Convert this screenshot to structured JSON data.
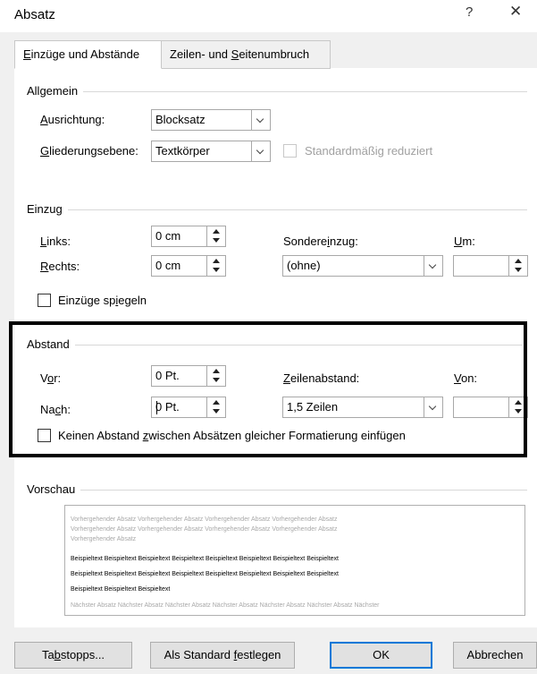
{
  "window": {
    "title": "Absatz",
    "help": "?",
    "close": "✕"
  },
  "tabs": [
    {
      "pre": "",
      "key": "E",
      "post": "inzüge und Abstände"
    },
    {
      "pre": "Zeilen- und ",
      "key": "S",
      "post": "eitenumbruch"
    }
  ],
  "general": {
    "group_label": "Allgemein",
    "alignment": {
      "pre": "",
      "key": "A",
      "post": "usrichtung:",
      "value": "Blocksatz"
    },
    "outline": {
      "pre": "",
      "key": "G",
      "post": "liederungsebene:",
      "value": "Textkörper"
    },
    "collapsed": {
      "label": "Standardmäßig reduziert",
      "checked": false
    }
  },
  "indent": {
    "group_label": "Einzug",
    "left": {
      "pre": "",
      "key": "L",
      "post": "inks:",
      "value": "0 cm"
    },
    "right": {
      "pre": "",
      "key": "R",
      "post": "echts:",
      "value": "0 cm"
    },
    "special": {
      "pre": "Sondere",
      "key": "i",
      "post": "nzug:",
      "value": "(ohne)"
    },
    "by": {
      "pre": "",
      "key": "U",
      "post": "m:",
      "value": ""
    },
    "mirror": {
      "pre": "Einzüge sp",
      "key": "i",
      "post": "egeln",
      "checked": false
    }
  },
  "spacing": {
    "group_label": "Abstand",
    "before": {
      "pre": "V",
      "key": "o",
      "post": "r:",
      "value": "0 Pt."
    },
    "after": {
      "pre": "Na",
      "key": "c",
      "post": "h:",
      "value": "0 Pt."
    },
    "line_spacing": {
      "pre": "",
      "key": "Z",
      "post": "eilenabstand:",
      "value": "1,5 Zeilen"
    },
    "at": {
      "pre": "",
      "key": "V",
      "post": "on:",
      "value": ""
    },
    "no_space": {
      "pre": "Keinen Abstand ",
      "key": "z",
      "post": "wischen Absätzen gleicher Formatierung einfügen",
      "checked": false
    }
  },
  "preview": {
    "group_label": "Vorschau",
    "prev_lines": [
      "Vorhergehender Absatz Vorhergehender Absatz Vorhergehender Absatz Vorhergehender Absatz",
      "Vorhergehender Absatz Vorhergehender Absatz Vorhergehender Absatz Vorhergehender Absatz",
      "Vorhergehender Absatz"
    ],
    "sample_lines": [
      "Beispieltext  Beispieltext  Beispieltext  Beispieltext  Beispieltext  Beispieltext  Beispieltext  Beispieltext",
      "Beispieltext  Beispieltext  Beispieltext  Beispieltext  Beispieltext  Beispieltext  Beispieltext  Beispieltext",
      "Beispieltext Beispieltext Beispieltext"
    ],
    "next_lines": [
      "Nächster Absatz Nächster Absatz Nächster Absatz Nächster Absatz Nächster Absatz Nächster Absatz Nächster"
    ]
  },
  "buttons": {
    "tabs": {
      "pre": "Ta",
      "key": "b",
      "post": "stopps..."
    },
    "set_default": {
      "pre": "Als Standard ",
      "key": "f",
      "post": "estlegen"
    },
    "ok": "OK",
    "cancel": "Abbrechen"
  }
}
